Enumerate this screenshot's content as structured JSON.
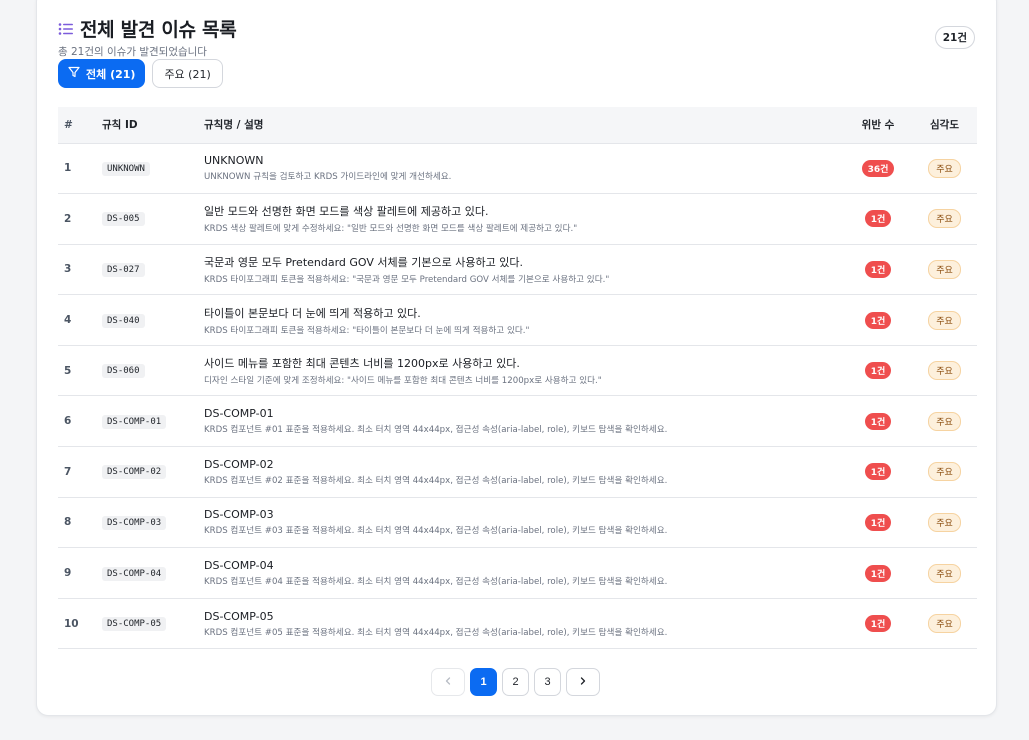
{
  "header": {
    "title": "전체 발견 이슈 목록",
    "subtitle": "총 21건의 이슈가 발견되었습니다",
    "total_badge": "21건"
  },
  "filters": [
    {
      "label": "전체 (21)",
      "active": true
    },
    {
      "label": "주요 (21)",
      "active": false
    }
  ],
  "table": {
    "columns": [
      "#",
      "규칙 ID",
      "규칙명 / 설명",
      "위반 수",
      "심각도"
    ],
    "rows": [
      {
        "num": "1",
        "id": "UNKNOWN",
        "name": "UNKNOWN",
        "desc": "UNKNOWN 규칙을 검토하고 KRDS 가이드라인에 맞게 개선하세요.",
        "count": "36건",
        "severity": "주요"
      },
      {
        "num": "2",
        "id": "DS-005",
        "name": "일반 모드와 선명한 화면 모드를 색상 팔레트에 제공하고 있다.",
        "desc": "KRDS 색상 팔레트에 맞게 수정하세요: \"일반 모드와 선명한 화면 모드를 색상 팔레트에 제공하고 있다.\"",
        "count": "1건",
        "severity": "주요"
      },
      {
        "num": "3",
        "id": "DS-027",
        "name": "국문과 영문 모두 Pretendard GOV 서체를 기본으로 사용하고 있다.",
        "desc": "KRDS 타이포그래피 토큰을 적용하세요: \"국문과 영문 모두 Pretendard GOV 서체를 기본으로 사용하고 있다.\"",
        "count": "1건",
        "severity": "주요"
      },
      {
        "num": "4",
        "id": "DS-040",
        "name": "타이틀이 본문보다 더 눈에 띄게 적용하고 있다.",
        "desc": "KRDS 타이포그래피 토큰을 적용하세요: \"타이틀이 본문보다 더 눈에 띄게 적용하고 있다.\"",
        "count": "1건",
        "severity": "주요"
      },
      {
        "num": "5",
        "id": "DS-060",
        "name": "사이드 메뉴를 포함한 최대 콘텐츠 너비를 1200px로 사용하고 있다.",
        "desc": "디자인 스타일 기준에 맞게 조정하세요: \"사이드 메뉴를 포함한 최대 콘텐츠 너비를 1200px로 사용하고 있다.\"",
        "count": "1건",
        "severity": "주요"
      },
      {
        "num": "6",
        "id": "DS-COMP-01",
        "name": "DS-COMP-01",
        "desc": "KRDS 컴포넌트 #01 표준을 적용하세요. 최소 터치 영역 44x44px, 접근성 속성(aria-label, role), 키보드 탐색을 확인하세요.",
        "count": "1건",
        "severity": "주요"
      },
      {
        "num": "7",
        "id": "DS-COMP-02",
        "name": "DS-COMP-02",
        "desc": "KRDS 컴포넌트 #02 표준을 적용하세요. 최소 터치 영역 44x44px, 접근성 속성(aria-label, role), 키보드 탐색을 확인하세요.",
        "count": "1건",
        "severity": "주요"
      },
      {
        "num": "8",
        "id": "DS-COMP-03",
        "name": "DS-COMP-03",
        "desc": "KRDS 컴포넌트 #03 표준을 적용하세요. 최소 터치 영역 44x44px, 접근성 속성(aria-label, role), 키보드 탐색을 확인하세요.",
        "count": "1건",
        "severity": "주요"
      },
      {
        "num": "9",
        "id": "DS-COMP-04",
        "name": "DS-COMP-04",
        "desc": "KRDS 컴포넌트 #04 표준을 적용하세요. 최소 터치 영역 44x44px, 접근성 속성(aria-label, role), 키보드 탐색을 확인하세요.",
        "count": "1건",
        "severity": "주요"
      },
      {
        "num": "10",
        "id": "DS-COMP-05",
        "name": "DS-COMP-05",
        "desc": "KRDS 컴포넌트 #05 표준을 적용하세요. 최소 터치 영역 44x44px, 접근성 속성(aria-label, role), 키보드 탐색을 확인하세요.",
        "count": "1건",
        "severity": "주요"
      }
    ]
  },
  "pagination": {
    "pages": [
      "1",
      "2",
      "3"
    ],
    "current": "1",
    "prev_icon": "chevron-left-icon",
    "next_icon": "chevron-right-icon"
  },
  "icons": {
    "title_icon": "list-icon",
    "filter_icon": "filter-icon"
  },
  "colors": {
    "accent": "#0b6bf2",
    "title_icon": "#7c5cdb",
    "violation_badge": "#ef4e4e",
    "severity_bg": "#fdf0dc"
  }
}
